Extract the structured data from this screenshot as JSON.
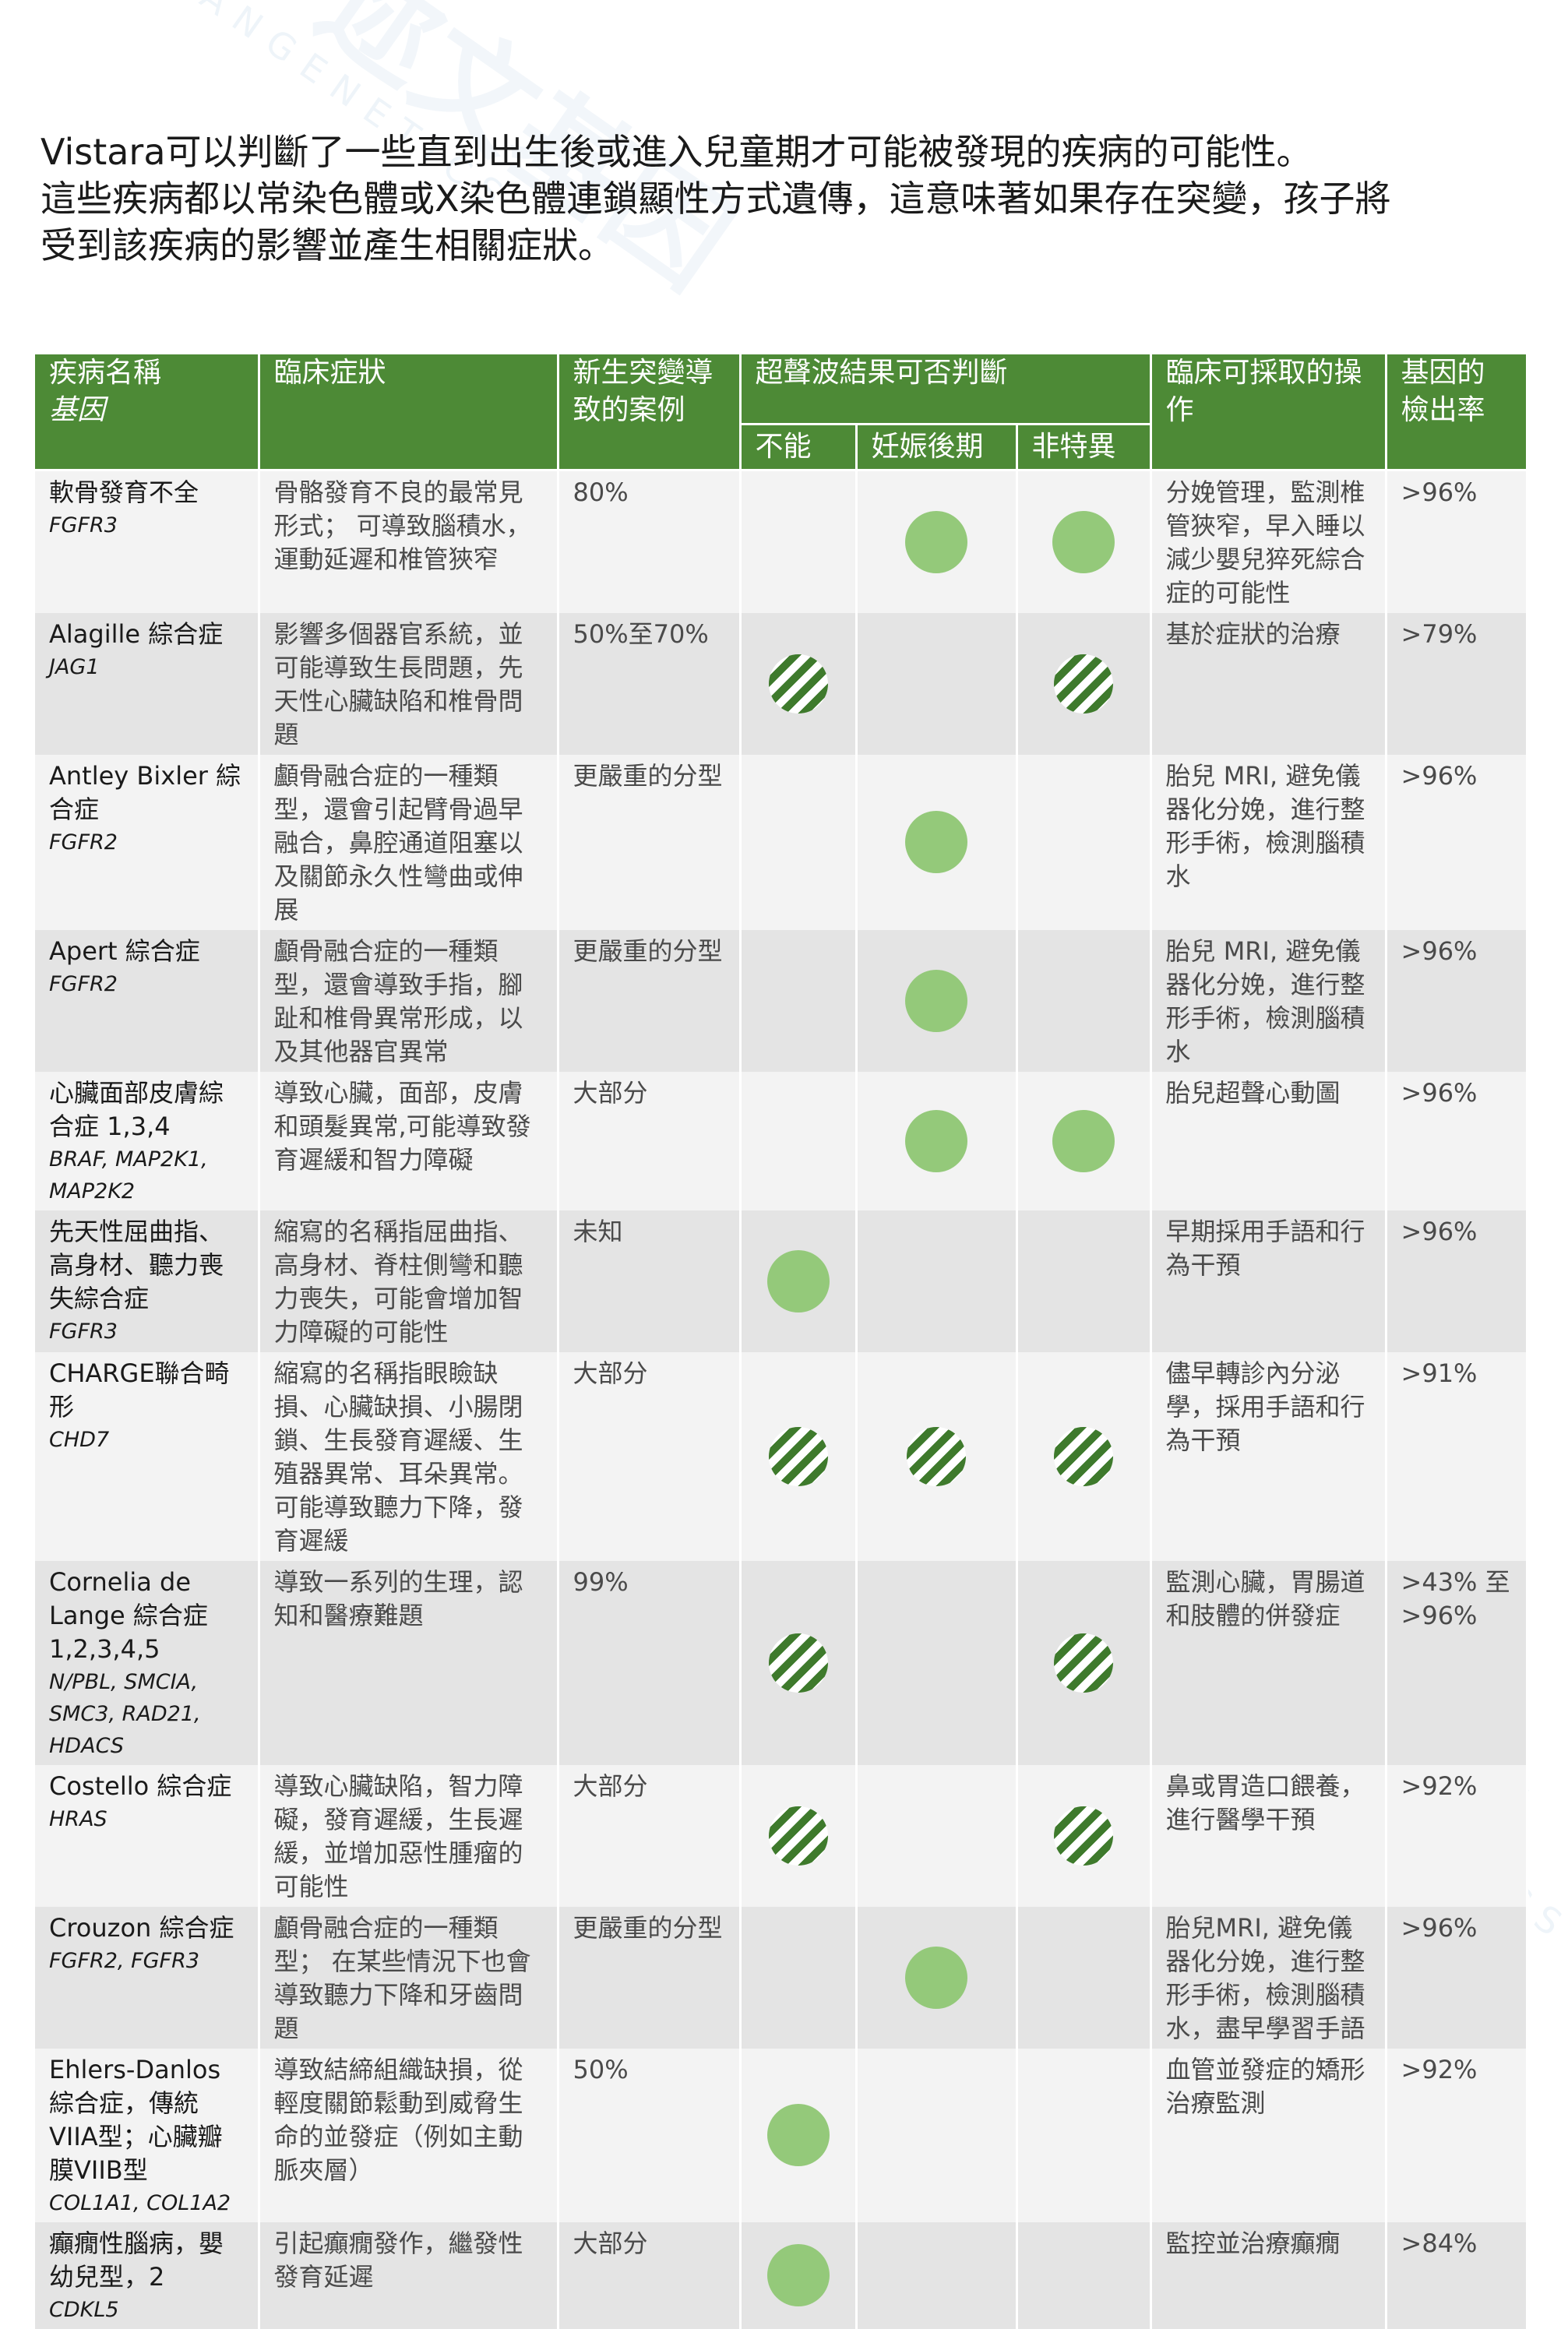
{
  "intro": [
    "Vistara可以判斷了一些直到出生後或進入兒童期才可能被發現的疾病的可能性。",
    "這些疾病都以常染色體或X染色體連鎖顯性方式遺傳，這意味著如果存在突變，孩子將",
    "受到該疾病的影響並產生相關症狀。"
  ],
  "watermark": {
    "brand": "迩文基因",
    "sub": "ANGENETICS"
  },
  "headers": {
    "disease": [
      "疾病名稱",
      "基因"
    ],
    "symptoms": "臨床症狀",
    "new_mutation": "新生突變導致的案例",
    "ultrasound": "超聲波結果可否判斷",
    "us_cannot": "不能",
    "us_late": "妊娠後期",
    "us_nonspecific": "非特異",
    "action": "臨床可採取的操作",
    "detection": "基因的檢出率"
  },
  "marker_legend": {
    "solid": "solid-dot",
    "striped": "striped-dot"
  },
  "rows": [
    {
      "name": "軟骨發育不全",
      "gene": "FGFR3",
      "symptoms": "骨骼發育不良的最常見形式； 可導致腦積水，運動延遲和椎管狹窄",
      "new_mutation": "80%",
      "marks": [
        "",
        "solid",
        "solid"
      ],
      "action": "分娩管理，監測椎管狹窄，早入睡以減少嬰兒猝死綜合症的可能性",
      "detection": ">96%"
    },
    {
      "name": "Alagille 綜合症",
      "gene": "JAG1",
      "symptoms": "影響多個器官系統，並可能導致生長問題，先天性心臟缺陷和椎骨問題",
      "new_mutation": "50%至70%",
      "marks": [
        "striped",
        "",
        "striped"
      ],
      "action": "基於症狀的治療",
      "detection": ">79%"
    },
    {
      "name": "Antley Bixler 綜合症",
      "gene": "FGFR2",
      "symptoms": "顱骨融合症的一種類型，還會引起臂骨過早融合，鼻腔通道阻塞以及關節永久性彎曲或伸展",
      "new_mutation": "更嚴重的分型",
      "marks": [
        "",
        "solid",
        ""
      ],
      "action": "胎兒 MRI, 避免儀器化分娩，進行整形手術，檢測腦積水",
      "detection": ">96%"
    },
    {
      "name": "Apert 綜合症",
      "gene": "FGFR2",
      "symptoms": "顱骨融合症的一種類型，還會導致手指，腳趾和椎骨異常形成，以及其他器官異常",
      "new_mutation": "更嚴重的分型",
      "marks": [
        "",
        "solid",
        ""
      ],
      "action": "胎兒 MRI, 避免儀器化分娩，進行整形手術，檢測腦積水",
      "detection": ">96%"
    },
    {
      "name": "心臟面部皮膚綜合症 1,3,4",
      "gene": "BRAF, MAP2K1, MAP2K2",
      "symptoms": "導致心臟，面部，皮膚和頭髮異常,可能導致發育遲緩和智力障礙",
      "new_mutation": "大部分",
      "marks": [
        "",
        "solid",
        "solid"
      ],
      "action": "胎兒超聲心動圖",
      "detection": ">96%"
    },
    {
      "name": "先天性屈曲指、高身材、聽力喪失綜合症",
      "gene": "FGFR3",
      "symptoms": "縮寫的名稱指屈曲指、高身材、脊柱側彎和聽力喪失，可能會增加智力障礙的可能性",
      "new_mutation": "未知",
      "marks": [
        "solid",
        "",
        ""
      ],
      "action": "早期採用手語和行為干預",
      "detection": ">96%"
    },
    {
      "name": "CHARGE聯合畸形",
      "gene": "CHD7",
      "symptoms": "縮寫的名稱指眼瞼缺損、心臟缺損、小腸閉鎖、生長發育遲緩、生殖器異常、耳朵異常。可能導致聽力下降，發育遲緩",
      "new_mutation": "大部分",
      "marks": [
        "striped",
        "striped",
        "striped"
      ],
      "action": "儘早轉診內分泌學，採用手語和行為干預",
      "detection": ">91%"
    },
    {
      "name": "Cornelia de Lange 綜合症 1,2,3,4,5",
      "gene": "N/PBL, SMCIA, SMC3, RAD21, HDACS",
      "symptoms": "導致一系列的生理，認知和醫療難題",
      "new_mutation": "99%",
      "marks": [
        "striped",
        "",
        "striped"
      ],
      "action": "監測心臟，胃腸道和肢體的併發症",
      "detection": ">43% 至 >96%"
    },
    {
      "name": "Costello 綜合症",
      "gene": "HRAS",
      "symptoms": "導致心臟缺陷，智力障礙，發育遲緩，生長遲緩，並增加惡性腫瘤的可能性",
      "new_mutation": "大部分",
      "marks": [
        "striped",
        "",
        "striped"
      ],
      "action": "鼻或胃造口餵養，進行醫學干預",
      "detection": ">92%"
    },
    {
      "name": "Crouzon 綜合症",
      "gene": "FGFR2, FGFR3",
      "symptoms": "顱骨融合症的一種類型； 在某些情況下也會導致聽力下降和牙齒問題",
      "new_mutation": "更嚴重的分型",
      "marks": [
        "",
        "solid",
        ""
      ],
      "action": "胎兒MRI, 避免儀器化分娩，進行整形手術，檢測腦積水，盡早學習手語",
      "detection": ">96%"
    },
    {
      "name": "Ehlers-Danlos 綜合症，傳統VIIA型；心臟瓣膜VIIB型",
      "gene": "COL1A1, COL1A2",
      "symptoms": "導致結締組織缺損，從輕度關節鬆動到威脅生命的並發症（例如主動脈夾層）",
      "new_mutation": "50%",
      "marks": [
        "solid",
        "",
        ""
      ],
      "action": "血管並發症的矯形治療監測",
      "detection": ">92%"
    },
    {
      "name": "癲癇性腦病，嬰幼兒型，2",
      "gene": "CDKL5",
      "symptoms": "引起癲癇發作，繼發性發育延遲",
      "new_mutation": "大部分",
      "marks": [
        "solid",
        "",
        ""
      ],
      "action": "監控並治療癲癇",
      "detection": ">84%"
    }
  ]
}
